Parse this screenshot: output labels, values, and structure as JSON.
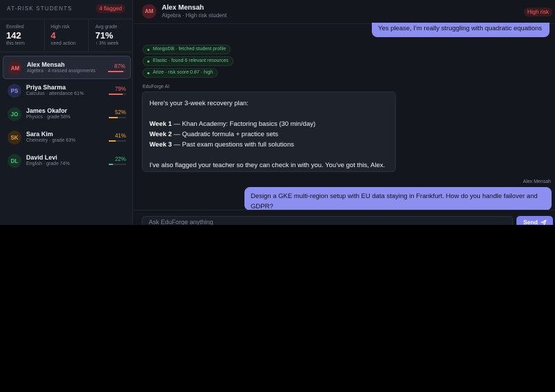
{
  "sidebar": {
    "title": "AT-RISK STUDENTS",
    "flag_badge": "4 flagged",
    "stats": [
      {
        "label": "Enrolled",
        "value": "142",
        "sub": "this term"
      },
      {
        "label": "High risk",
        "value": "4",
        "sub": "need action"
      },
      {
        "label": "Avg grade",
        "value": "71%",
        "sub": "↑ 3% week"
      }
    ],
    "students": [
      {
        "initials": "AM",
        "name": "Alex Mensah",
        "meta": "Algebra · 4 missed assignments",
        "pct": "87%",
        "risk": 0.87,
        "color": "#f26060",
        "avatar_bg": "#4a1e24",
        "avatar_fg": "#f07070"
      },
      {
        "initials": "PS",
        "name": "Priya Sharma",
        "meta": "Calculus · attendance 61%",
        "pct": "79%",
        "risk": 0.79,
        "color": "#f26060",
        "avatar_bg": "#262a4a",
        "avatar_fg": "#8e92f0"
      },
      {
        "initials": "JO",
        "name": "James Okafor",
        "meta": "Physics · grade 58%",
        "pct": "52%",
        "risk": 0.52,
        "color": "#f0a238",
        "avatar_bg": "#163326",
        "avatar_fg": "#4cc487"
      },
      {
        "initials": "SK",
        "name": "Sara Kim",
        "meta": "Chemistry · grade 63%",
        "pct": "41%",
        "risk": 0.41,
        "color": "#f0a238",
        "avatar_bg": "#3a2a14",
        "avatar_fg": "#e0a040"
      },
      {
        "initials": "DL",
        "name": "David Levi",
        "meta": "English · grade 74%",
        "pct": "22%",
        "risk": 0.22,
        "color": "#3fc489",
        "avatar_bg": "#163326",
        "avatar_fg": "#4cc487"
      }
    ]
  },
  "header": {
    "initials": "AM",
    "name": "Alex Mensah",
    "subtitle": "Algebra · High risk student",
    "risk_badge": "High risk"
  },
  "chat": {
    "user_message_1": "Yes please, I'm really struggling with quadratic equations",
    "tool_calls": [
      "MongoDB · fetched student profile",
      "Elastic · found 6 relevant resources",
      "Arize · risk score 0.87 · high"
    ],
    "ai_label": "EduForge AI",
    "ai_message": {
      "intro": "Here's your 3-week recovery plan:",
      "weeks": [
        {
          "label": "Week 1",
          "text": " — Khan Academy: Factoring basics (30 min/day)"
        },
        {
          "label": "Week 2",
          "text": " — Quadratic formula + practice sets"
        },
        {
          "label": "Week 3",
          "text": " — Past exam questions with full solutions"
        }
      ],
      "outro": "I've also flagged your teacher so they can check in with you. You've got this, Alex."
    },
    "user_label": "Alex Mensah",
    "user_message_2": "Design a GKE multi-region setup with EU data staying in Frankfurt. How do you handle failover and GDPR?"
  },
  "composer": {
    "placeholder": "Ask EduForge anything",
    "send_label": "Send",
    "send_icon": "paper-plane-icon"
  }
}
